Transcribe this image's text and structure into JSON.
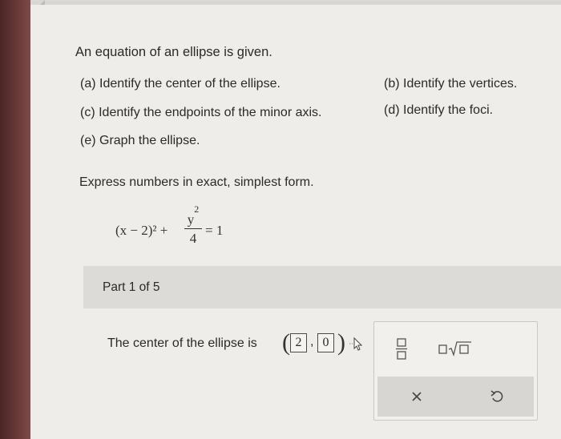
{
  "problem": {
    "intro": "An equation of an ellipse is given.",
    "parts": {
      "a": "(a) Identify the center of the ellipse.",
      "b": "(b) Identify the vertices.",
      "c": "(c) Identify the endpoints of the minor axis.",
      "d": "(d) Identify the foci.",
      "e": "(e) Graph the ellipse."
    },
    "instruction": "Express numbers in exact, simplest form.",
    "equation": {
      "left": "(x − 2)² +",
      "numerator": "y",
      "numerator_exp": "2",
      "denominator": "4",
      "right": "= 1"
    }
  },
  "part": {
    "label": "Part 1 of 5",
    "prompt": "The center of the ellipse is",
    "answer": {
      "x": "2",
      "y": "0"
    }
  },
  "palette": {
    "fraction_icon": "fraction-icon",
    "sqrt_icon": "sqrt-icon",
    "clear_icon": "clear-icon",
    "undo_icon": "undo-icon"
  },
  "colors": {
    "strip": "#5a2f2f",
    "panel": "#dcdbd7",
    "background": "#eeede9"
  }
}
